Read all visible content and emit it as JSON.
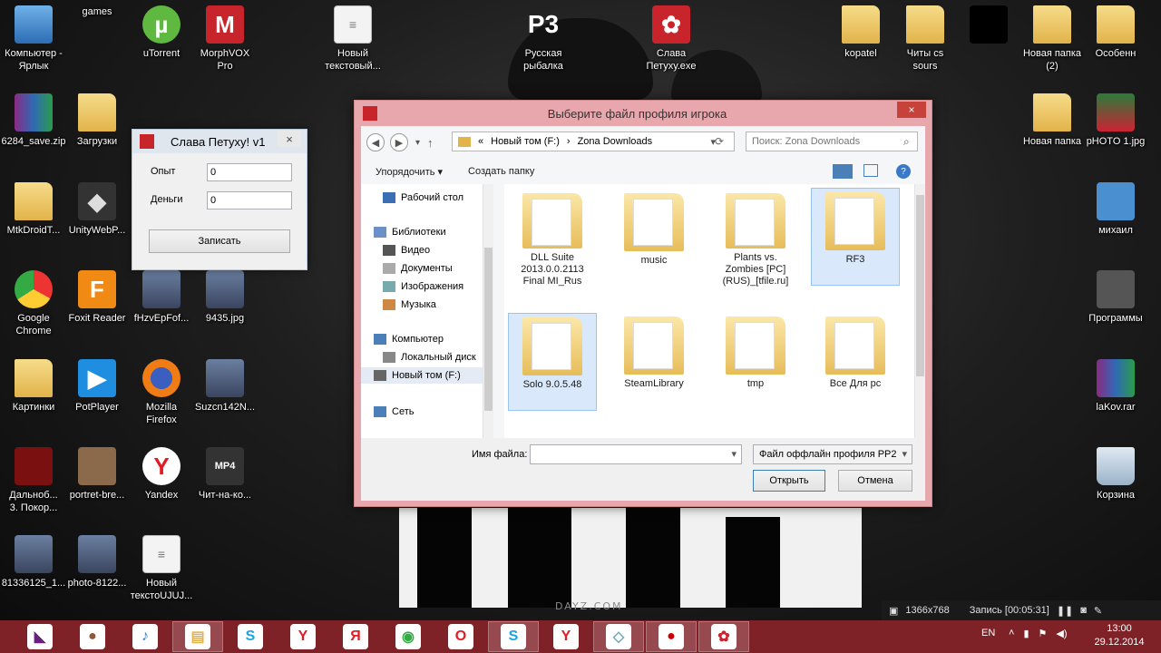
{
  "desktop": {
    "icons": [
      {
        "label": "Компьютер -\nЯрлык",
        "icon": "computer-icon"
      },
      {
        "label": "games",
        "icon": "clock-icon"
      },
      {
        "label": "uTorrent",
        "icon": "utorrent-icon"
      },
      {
        "label": "MorphVOX\nPro",
        "icon": "morphvox-icon"
      },
      {
        "label": "Новый\nтекстовый...",
        "icon": "text-document-icon"
      },
      {
        "label": "Русская\nрыбалка",
        "icon": "ps3-icon"
      },
      {
        "label": "Слава\nПетуху.exe",
        "icon": "app-icon"
      },
      {
        "label": "kopatel",
        "icon": "folder-icon"
      },
      {
        "label": "Читы cs\nsours",
        "icon": "folder-icon"
      },
      {
        "label": "",
        "icon": "black-square-icon"
      },
      {
        "label": "Новая папка\n(2)",
        "icon": "folder-icon"
      },
      {
        "label": "Особенн",
        "icon": "folder-icon"
      },
      {
        "label": "6284_save.zip",
        "icon": "winrar-icon"
      },
      {
        "label": "Загрузки",
        "icon": "downloads-folder-icon"
      },
      {
        "label": "Новая папка",
        "icon": "folder-icon"
      },
      {
        "label": "pHOTO 1.jpg",
        "icon": "photo-icon"
      },
      {
        "label": "MtkDroidT...",
        "icon": "folder-icon"
      },
      {
        "label": "UnityWebP...",
        "icon": "unity-icon"
      },
      {
        "label": "михаил",
        "icon": "mikhail-icon"
      },
      {
        "label": "Google\nChrome",
        "icon": "chrome-icon"
      },
      {
        "label": "Foxit Reader",
        "icon": "foxit-icon"
      },
      {
        "label": "fHzvEpFof...",
        "icon": "image-file-icon"
      },
      {
        "label": "9435.jpg",
        "icon": "image-file-icon"
      },
      {
        "label": "Программы",
        "icon": "chip-icon"
      },
      {
        "label": "Картинки",
        "icon": "folder-icon"
      },
      {
        "label": "PotPlayer",
        "icon": "potplayer-icon"
      },
      {
        "label": "Mozilla\nFirefox",
        "icon": "firefox-icon"
      },
      {
        "label": "Suzcn142N...",
        "icon": "image-file-icon"
      },
      {
        "label": "laKov.rar",
        "icon": "winrar-icon"
      },
      {
        "label": "Дальноб...\n3. Покор...",
        "icon": "truck-icon"
      },
      {
        "label": "portret-bre...",
        "icon": "portrait-icon"
      },
      {
        "label": "Yandex",
        "icon": "yandex-icon"
      },
      {
        "label": "Чит-на-ко...",
        "icon": "mp4-icon"
      },
      {
        "label": "Корзина",
        "icon": "recycle-bin-icon"
      },
      {
        "label": "81336125_1...",
        "icon": "image-file-icon"
      },
      {
        "label": "photo-8122...",
        "icon": "image-file-icon"
      },
      {
        "label": "Новый\nтекстоUJUJ...",
        "icon": "text-document-icon"
      }
    ],
    "watermark": "DAYZ.COM"
  },
  "app_window": {
    "title": "Слава Петуху!  v1",
    "opyt_label": "Опыт",
    "opyt_value": "0",
    "dengi_label": "Деньги",
    "dengi_value": "0",
    "write_button": "Записать",
    "close": "×"
  },
  "dialog": {
    "title": "Выберите файл профиля игрока",
    "close": "×",
    "breadcrumb": [
      "«",
      "Новый том (F:)",
      "›",
      "Zona Downloads"
    ],
    "search_placeholder": "Поиск: Zona Downloads",
    "toolbar": {
      "organize": "Упорядочить ▾",
      "new_folder": "Создать папку"
    },
    "tree": [
      {
        "label": "Рабочий стол",
        "icon": "desktop-icon"
      },
      {
        "label": "Библиотеки",
        "icon": "libraries-icon"
      },
      {
        "label": "Видео",
        "icon": "video-icon"
      },
      {
        "label": "Документы",
        "icon": "documents-icon"
      },
      {
        "label": "Изображения",
        "icon": "pictures-icon"
      },
      {
        "label": "Музыка",
        "icon": "music-icon"
      },
      {
        "label": "Компьютер",
        "icon": "computer-icon"
      },
      {
        "label": "Локальный диск",
        "icon": "drive-icon"
      },
      {
        "label": "Новый том (F:)",
        "icon": "drive-icon"
      },
      {
        "label": "Сеть",
        "icon": "network-icon"
      }
    ],
    "files": [
      {
        "label": "DLL Suite\n2013.0.0.2113\nFinal MI_Rus",
        "selected": false
      },
      {
        "label": "music",
        "selected": false
      },
      {
        "label": "Plants vs.\nZombies [PC]\n(RUS)_[tfile.ru]",
        "selected": false
      },
      {
        "label": "RF3",
        "selected": true
      },
      {
        "label": "Solo 9.0.5.48",
        "selected": true
      },
      {
        "label": "SteamLibrary",
        "selected": false
      },
      {
        "label": "tmp",
        "selected": false
      },
      {
        "label": "Все Для pc",
        "selected": false
      }
    ],
    "filename_label": "Имя файла:",
    "filename_value": "",
    "filter": "Файл оффлайн профиля PP2",
    "open_button": "Открыть",
    "cancel_button": "Отмена"
  },
  "recording": {
    "resolution": "1366x768",
    "status": "Запись [00:05:31]"
  },
  "taskbar": {
    "items": [
      "visual-studio-icon",
      "user-photo-icon",
      "audio-icon",
      "explorer-icon",
      "skype-icon",
      "yandex-icon",
      "yandex-browser-icon",
      "chrome-icon",
      "opera-icon",
      "skype-icon",
      "yandex-icon",
      "app-icon",
      "record-icon",
      "petuh-app-icon"
    ],
    "lang": "EN",
    "time": "13:00",
    "date": "29.12.2014"
  }
}
